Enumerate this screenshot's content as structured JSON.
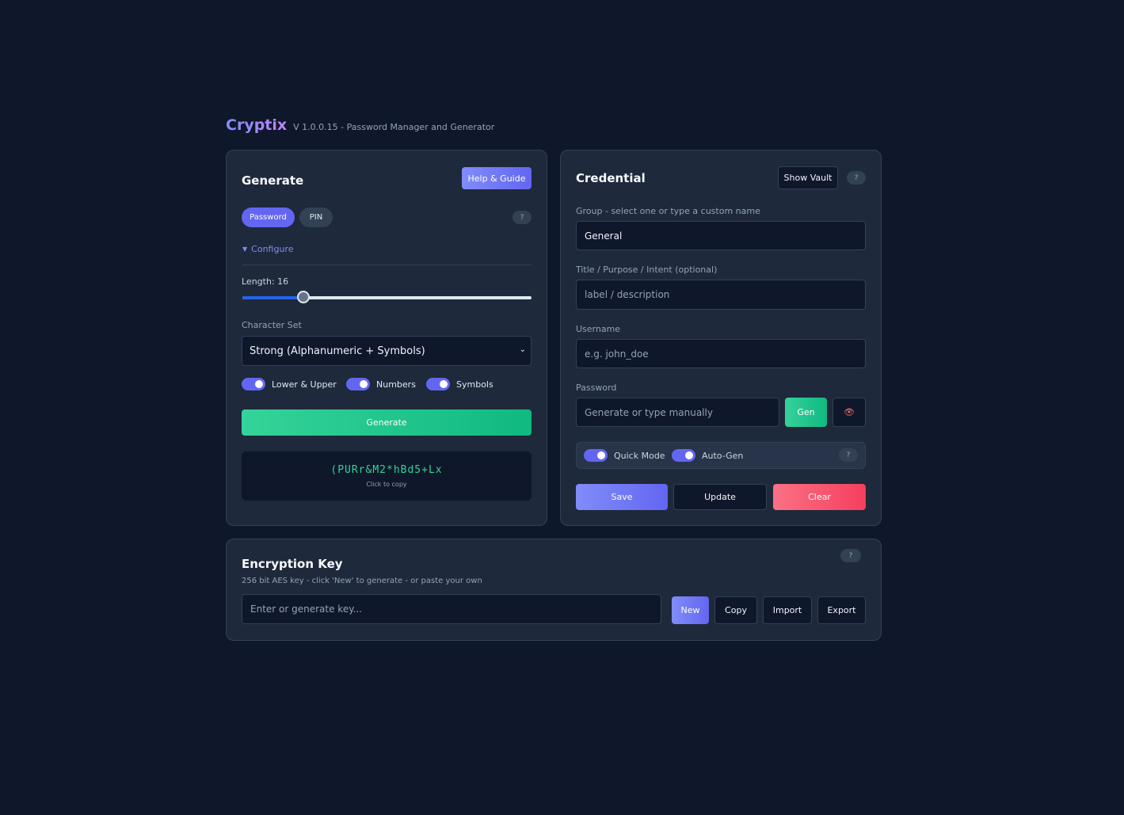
{
  "header": {
    "brand": "Cryptix",
    "version": "V 1.0.0.15 - Password Manager and Generator"
  },
  "generate": {
    "title": "Generate",
    "help_button": "Help & Guide",
    "mode_tabs": [
      "Password",
      "PIN"
    ],
    "active_mode": "Password",
    "help_q": "?",
    "configure_label": "Configure",
    "length_label": "Length: 16",
    "length_value": 16,
    "length_fraction": 0.21,
    "charset_label": "Character Set",
    "charset_value": "Strong (Alphanumeric + Symbols)",
    "toggles": [
      {
        "label": "Lower & Upper",
        "on": true
      },
      {
        "label": "Numbers",
        "on": true
      },
      {
        "label": "Symbols",
        "on": true
      }
    ],
    "generate_button": "Generate",
    "output_password": "(PURr&M2*hBd5+Lx",
    "output_hint": "Click to copy"
  },
  "credential": {
    "title": "Credential",
    "show_vault_button": "Show Vault",
    "help_q": "?",
    "group_label": "Group - select one or type a custom name",
    "group_value": "General",
    "title_label": "Title / Purpose / Intent (optional)",
    "title_placeholder": "label / description",
    "username_label": "Username",
    "username_placeholder": "e.g. john_doe",
    "password_label": "Password",
    "password_placeholder": "Generate or type manually",
    "gen_button": "Gen",
    "quick_mode_label": "Quick Mode",
    "auto_gen_label": "Auto-Gen",
    "quick_help_q": "?",
    "save_button": "Save",
    "update_button": "Update",
    "clear_button": "Clear"
  },
  "encryption": {
    "title": "Encryption Key",
    "subtitle": "256 bit AES key - click 'New' to generate - or paste your own",
    "help_q": "?",
    "key_placeholder": "Enter or generate key...",
    "new_button": "New",
    "copy_button": "Copy",
    "import_button": "Import",
    "export_button": "Export"
  },
  "colors": {
    "background": "#0f172a",
    "card": "#1e293b",
    "accent": "#6366f1",
    "success": "#10b981",
    "danger": "#f43f5e"
  }
}
